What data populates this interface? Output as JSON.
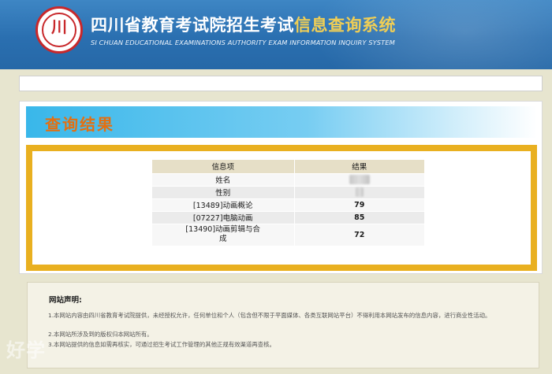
{
  "header": {
    "logo_glyph": "川",
    "title_main": "四川省教育考试院招生考试",
    "title_highlight": "信息查询系统",
    "subtitle": "SI CHUAN EDUCATIONAL EXAMINATIONS AUTHORITY EXAM INFORMATION INQUIRY SYSTEM"
  },
  "result": {
    "title": "查询结果",
    "columns": [
      "信息项",
      "结果"
    ],
    "rows": [
      {
        "item": "姓名",
        "value": ""
      },
      {
        "item": "性别",
        "value": ""
      },
      {
        "item": "[13489]动画概论",
        "value": "79"
      },
      {
        "item": "[07227]电脑动画",
        "value": "85"
      },
      {
        "item": "[13490]动画剪辑与合成",
        "value": "72"
      }
    ]
  },
  "notice": {
    "title": "网站声明:",
    "lines": [
      "1.本网站内容由四川省教育考试院提供，未经授权允许，任何单位和个人（包含但不限于平面媒体、各类互联网站平台）不得利用本网站发布的信息内容，进行商业性活动。",
      "2.本网站所涉及到的版权归本网站所有。",
      "3.本网站提供的信息如需再核实，可通过招生考试工作管理的其他正规有效渠道再查核。"
    ]
  },
  "watermark": "好学"
}
